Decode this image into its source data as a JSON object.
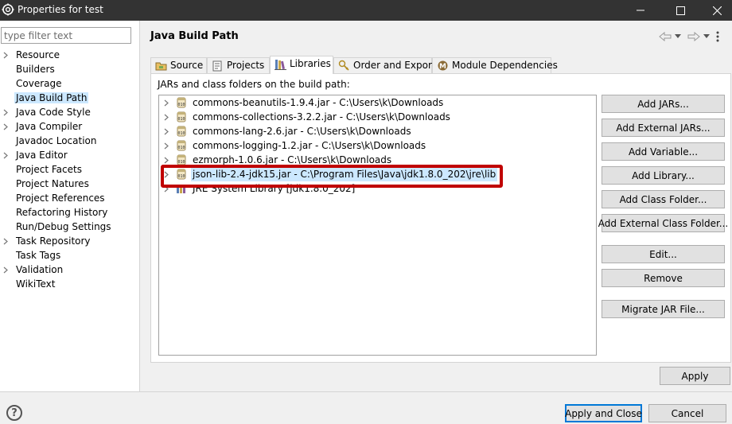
{
  "window": {
    "title": "Properties for test",
    "minimize_icon": "minimize-icon",
    "maximize_icon": "maximize-icon",
    "close_icon": "close-icon"
  },
  "sidebar": {
    "filter_placeholder": "type filter text",
    "items": [
      {
        "label": "Resource",
        "expandable": true
      },
      {
        "label": "Builders",
        "expandable": false
      },
      {
        "label": "Coverage",
        "expandable": false
      },
      {
        "label": "Java Build Path",
        "expandable": false,
        "selected": true
      },
      {
        "label": "Java Code Style",
        "expandable": true
      },
      {
        "label": "Java Compiler",
        "expandable": true
      },
      {
        "label": "Javadoc Location",
        "expandable": false
      },
      {
        "label": "Java Editor",
        "expandable": true
      },
      {
        "label": "Project Facets",
        "expandable": false
      },
      {
        "label": "Project Natures",
        "expandable": false
      },
      {
        "label": "Project References",
        "expandable": false
      },
      {
        "label": "Refactoring History",
        "expandable": false
      },
      {
        "label": "Run/Debug Settings",
        "expandable": false
      },
      {
        "label": "Task Repository",
        "expandable": true
      },
      {
        "label": "Task Tags",
        "expandable": false
      },
      {
        "label": "Validation",
        "expandable": true
      },
      {
        "label": "WikiText",
        "expandable": false
      }
    ]
  },
  "main": {
    "title": "Java Build Path",
    "tabs": [
      {
        "label": "Source",
        "icon": "source-folder-icon"
      },
      {
        "label": "Projects",
        "icon": "projects-icon"
      },
      {
        "label": "Libraries",
        "icon": "libraries-icon",
        "active": true
      },
      {
        "label": "Order and Export",
        "icon": "order-export-icon"
      },
      {
        "label": "Module Dependencies",
        "icon": "module-icon"
      }
    ],
    "panel_label": "JARs and class folders on the build path:",
    "libraries": [
      {
        "text": "commons-beanutils-1.9.4.jar - C:\\Users\\k\\Downloads",
        "icon": "jar-icon"
      },
      {
        "text": "commons-collections-3.2.2.jar - C:\\Users\\k\\Downloads",
        "icon": "jar-icon"
      },
      {
        "text": "commons-lang-2.6.jar - C:\\Users\\k\\Downloads",
        "icon": "jar-icon"
      },
      {
        "text": "commons-logging-1.2.jar - C:\\Users\\k\\Downloads",
        "icon": "jar-icon"
      },
      {
        "text": "ezmorph-1.0.6.jar - C:\\Users\\k\\Downloads",
        "icon": "jar-icon"
      },
      {
        "text": "json-lib-2.4-jdk15.jar - C:\\Program Files\\Java\\jdk1.8.0_202\\jre\\lib",
        "icon": "jar-icon",
        "selected": true
      },
      {
        "text": "JRE System Library [jdk1.8.0_202]",
        "icon": "library-icon"
      }
    ],
    "buttons": {
      "add_jars": "Add JARs...",
      "add_external_jars": "Add External JARs...",
      "add_variable": "Add Variable...",
      "add_library": "Add Library...",
      "add_class_folder": "Add Class Folder...",
      "add_external_class_folder": "Add External Class Folder...",
      "edit": "Edit...",
      "remove": "Remove",
      "migrate_jar": "Migrate JAR File...",
      "apply": "Apply"
    }
  },
  "footer": {
    "help": "?",
    "apply_and_close": "Apply and Close",
    "cancel": "Cancel"
  },
  "colors": {
    "titlebar": "#333333",
    "selection": "#cce8ff",
    "highlight_box": "#c00000",
    "default_button_border": "#0078d7"
  }
}
